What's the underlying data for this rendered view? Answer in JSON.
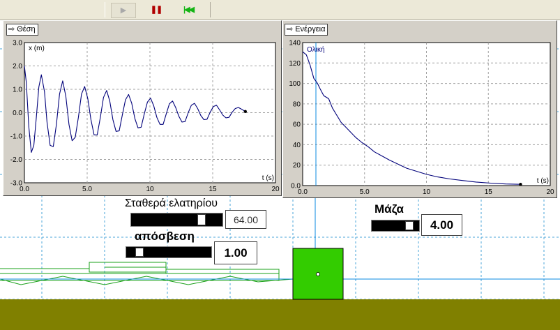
{
  "toolbar": {
    "play_icon": "play-icon",
    "pause_icon": "pause-icon",
    "reset_icon": "rewind-to-start-icon",
    "play_glyph": "▶",
    "pause_glyph": "❚❚",
    "reset_glyph": "|◀◀"
  },
  "panels": {
    "position": {
      "button_label": "Θέση",
      "arrow": "⇨"
    },
    "energy": {
      "button_label": "Ενέργεια",
      "arrow": "⇨"
    }
  },
  "controls": {
    "spring_constant": {
      "label": "Σταθερά ελατηρίου",
      "value": "64.00",
      "fill_fraction": 0.8
    },
    "damping": {
      "label": "απόσβεση",
      "value": "1.00",
      "fill_fraction": 0.12
    },
    "mass": {
      "label": "Μάζα",
      "value": "4.00",
      "fill_fraction": 0.85
    }
  },
  "colors": {
    "curve": "#00007a",
    "grid": "#4aa4d8",
    "spring": "#1aa01a",
    "block": "#33cc00",
    "ground": "#808000",
    "guide": "#0a88e0"
  },
  "chart_data": [
    {
      "type": "line",
      "title": "Θέση",
      "ylabel": "x (m)",
      "xlabel": "t (s)",
      "xlim": [
        0,
        20
      ],
      "ylim": [
        -3,
        3
      ],
      "x_ticks": [
        "0.0",
        "5.0",
        "10",
        "15",
        "20"
      ],
      "y_ticks": [
        "3.0",
        "2.0",
        "1.0",
        "0.0",
        "-1.0",
        "-2.0",
        "-3.0"
      ],
      "grid": true,
      "series": [
        {
          "values": [
            [
              0.0,
              2.0
            ],
            [
              0.15,
              1.3
            ],
            [
              0.35,
              -0.6
            ],
            [
              0.55,
              -1.7
            ],
            [
              0.75,
              -1.4
            ],
            [
              0.95,
              -0.2
            ],
            [
              1.15,
              1.1
            ],
            [
              1.35,
              1.62
            ],
            [
              1.6,
              0.9
            ],
            [
              1.8,
              -0.4
            ],
            [
              2.05,
              -1.4
            ],
            [
              2.3,
              -1.45
            ],
            [
              2.55,
              -0.5
            ],
            [
              2.8,
              0.8
            ],
            [
              3.05,
              1.36
            ],
            [
              3.3,
              0.7
            ],
            [
              3.55,
              -0.5
            ],
            [
              3.8,
              -1.2
            ],
            [
              4.05,
              -1.05
            ],
            [
              4.3,
              -0.2
            ],
            [
              4.55,
              0.8
            ],
            [
              4.8,
              1.12
            ],
            [
              5.05,
              0.6
            ],
            [
              5.3,
              -0.3
            ],
            [
              5.55,
              -0.95
            ],
            [
              5.8,
              -0.95
            ],
            [
              6.05,
              -0.2
            ],
            [
              6.3,
              0.65
            ],
            [
              6.55,
              0.95
            ],
            [
              6.8,
              0.5
            ],
            [
              7.05,
              -0.3
            ],
            [
              7.3,
              -0.8
            ],
            [
              7.55,
              -0.78
            ],
            [
              7.8,
              -0.1
            ],
            [
              8.05,
              0.55
            ],
            [
              8.3,
              0.78
            ],
            [
              8.55,
              0.4
            ],
            [
              8.8,
              -0.25
            ],
            [
              9.05,
              -0.65
            ],
            [
              9.3,
              -0.62
            ],
            [
              9.55,
              -0.05
            ],
            [
              9.8,
              0.45
            ],
            [
              10.05,
              0.62
            ],
            [
              10.3,
              0.3
            ],
            [
              10.55,
              -0.2
            ],
            [
              10.8,
              -0.5
            ],
            [
              11.05,
              -0.5
            ],
            [
              11.3,
              -0.05
            ],
            [
              11.55,
              0.38
            ],
            [
              11.8,
              0.5
            ],
            [
              12.05,
              0.22
            ],
            [
              12.3,
              -0.15
            ],
            [
              12.55,
              -0.4
            ],
            [
              12.8,
              -0.38
            ],
            [
              13.05,
              0.0
            ],
            [
              13.3,
              0.32
            ],
            [
              13.55,
              0.4
            ],
            [
              13.8,
              0.18
            ],
            [
              14.05,
              -0.12
            ],
            [
              14.3,
              -0.3
            ],
            [
              14.55,
              -0.28
            ],
            [
              14.8,
              0.02
            ],
            [
              15.05,
              0.26
            ],
            [
              15.3,
              0.32
            ],
            [
              15.55,
              0.12
            ],
            [
              15.8,
              -0.1
            ],
            [
              16.05,
              -0.22
            ],
            [
              16.3,
              -0.2
            ],
            [
              16.55,
              0.02
            ],
            [
              16.8,
              0.18
            ],
            [
              17.05,
              0.22
            ],
            [
              17.3,
              0.15
            ],
            [
              17.6,
              0.05
            ]
          ]
        }
      ],
      "end_point": [
        17.6,
        0.05
      ]
    },
    {
      "type": "line",
      "title": "Ενέργεια",
      "ylabel": "",
      "xlabel": "t (s)",
      "xlim": [
        0,
        20
      ],
      "ylim": [
        0,
        140
      ],
      "x_ticks": [
        "0.0",
        "5.0",
        "10",
        "15",
        "20"
      ],
      "y_ticks": [
        "140",
        "120",
        "100",
        "80",
        "60",
        "40",
        "20",
        "0.0"
      ],
      "grid": true,
      "series": [
        {
          "name": "Ολική",
          "values": [
            [
              0.0,
              131
            ],
            [
              0.3,
              128
            ],
            [
              0.6,
              118
            ],
            [
              0.9,
              105
            ],
            [
              1.2,
              100
            ],
            [
              1.4,
              95
            ],
            [
              1.7,
              88
            ],
            [
              2.1,
              85
            ],
            [
              2.4,
              76
            ],
            [
              2.7,
              70
            ],
            [
              3.1,
              62
            ],
            [
              3.5,
              57
            ],
            [
              3.9,
              52
            ],
            [
              4.3,
              47
            ],
            [
              4.8,
              42
            ],
            [
              5.3,
              38
            ],
            [
              5.8,
              33
            ],
            [
              6.4,
              29
            ],
            [
              7.0,
              25
            ],
            [
              7.7,
              21
            ],
            [
              8.4,
              17
            ],
            [
              9.2,
              14
            ],
            [
              10.0,
              11
            ],
            [
              10.9,
              8.5
            ],
            [
              11.9,
              6.5
            ],
            [
              12.9,
              5
            ],
            [
              14.0,
              3.5
            ],
            [
              15.2,
              2.4
            ],
            [
              16.4,
              1.6
            ],
            [
              17.6,
              1.2
            ]
          ]
        }
      ],
      "end_point": [
        17.6,
        1.2
      ]
    }
  ]
}
